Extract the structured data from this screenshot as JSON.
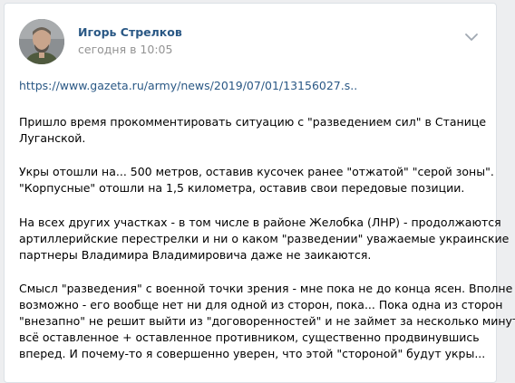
{
  "post": {
    "author": "Игорь Стрелков",
    "time": "сегодня в 10:05",
    "link": "https://www.gazeta.ru/army/news/2019/07/01/13156027.s..",
    "paragraphs": [
      [
        "Пришло время прокомментировать ситуацию с \"разведением сил\" в Станице",
        "Луганской."
      ],
      [
        "Укры отошли на... 500 метров, оставив кусочек ранее \"отжатой\" \"серой зоны\".",
        "\"Корпусные\" отошли на 1,5 километра, оставив свои передовые позиции."
      ],
      [
        "На всех других участках - в том числе в районе Желобка (ЛНР) - продолжаются",
        "артиллерийские перестрелки и ни о каком \"разведении\" уважаемые украинские",
        "партнеры Владимира Владимировича даже не заикаются."
      ],
      [
        "Смысл \"разведения\" с военной точки зрения - мне пока не до конца ясен. Вполне",
        "возможно - его вообще нет ни для одной из сторон, пока... Пока одна из сторон",
        "\"внезапно\" не решит выйти из \"договоренностей\" и не займет за несколько минут",
        "всё оставленное + оставленное противником, существенно продвинувшись",
        "вперед. И почему-то я совершенно уверен, что этой \"стороной\" будут укры..."
      ]
    ]
  }
}
